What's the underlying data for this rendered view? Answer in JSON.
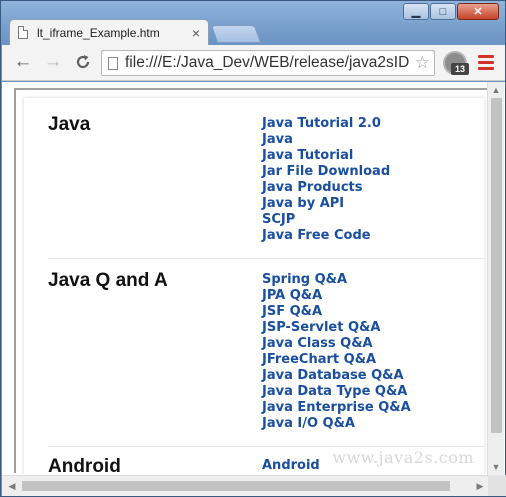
{
  "window": {
    "controls": {
      "minimize": "▁",
      "maximize": "□",
      "close": "✕"
    }
  },
  "tab": {
    "title": "lt_iframe_Example.htm",
    "close": "×"
  },
  "toolbar": {
    "back": "←",
    "forward": "→",
    "reload": "C",
    "url": "file:///E:/Java_Dev/WEB/release/java2sID",
    "star": "☆",
    "extension_badge": "13"
  },
  "sections": [
    {
      "heading": "Java",
      "links": [
        "Java Tutorial 2.0",
        "Java",
        "Java Tutorial",
        "Jar File Download",
        "Java Products",
        "Java by API",
        "SCJP",
        "Java Free Code"
      ]
    },
    {
      "heading": "Java Q and A",
      "links": [
        "Spring Q&A",
        "JPA Q&A",
        "JSF Q&A",
        "JSP-Servlet Q&A",
        "Java Class Q&A",
        "JFreeChart Q&A",
        "Java Database Q&A",
        "Java Data Type Q&A",
        "Java Enterprise Q&A",
        "Java I/O Q&A"
      ]
    },
    {
      "heading": "Android",
      "links": [
        "Android"
      ]
    }
  ],
  "watermark": "www.java2s.com",
  "scrollbars": {
    "up": "▲",
    "down": "▼",
    "left": "◀",
    "right": "▶"
  }
}
